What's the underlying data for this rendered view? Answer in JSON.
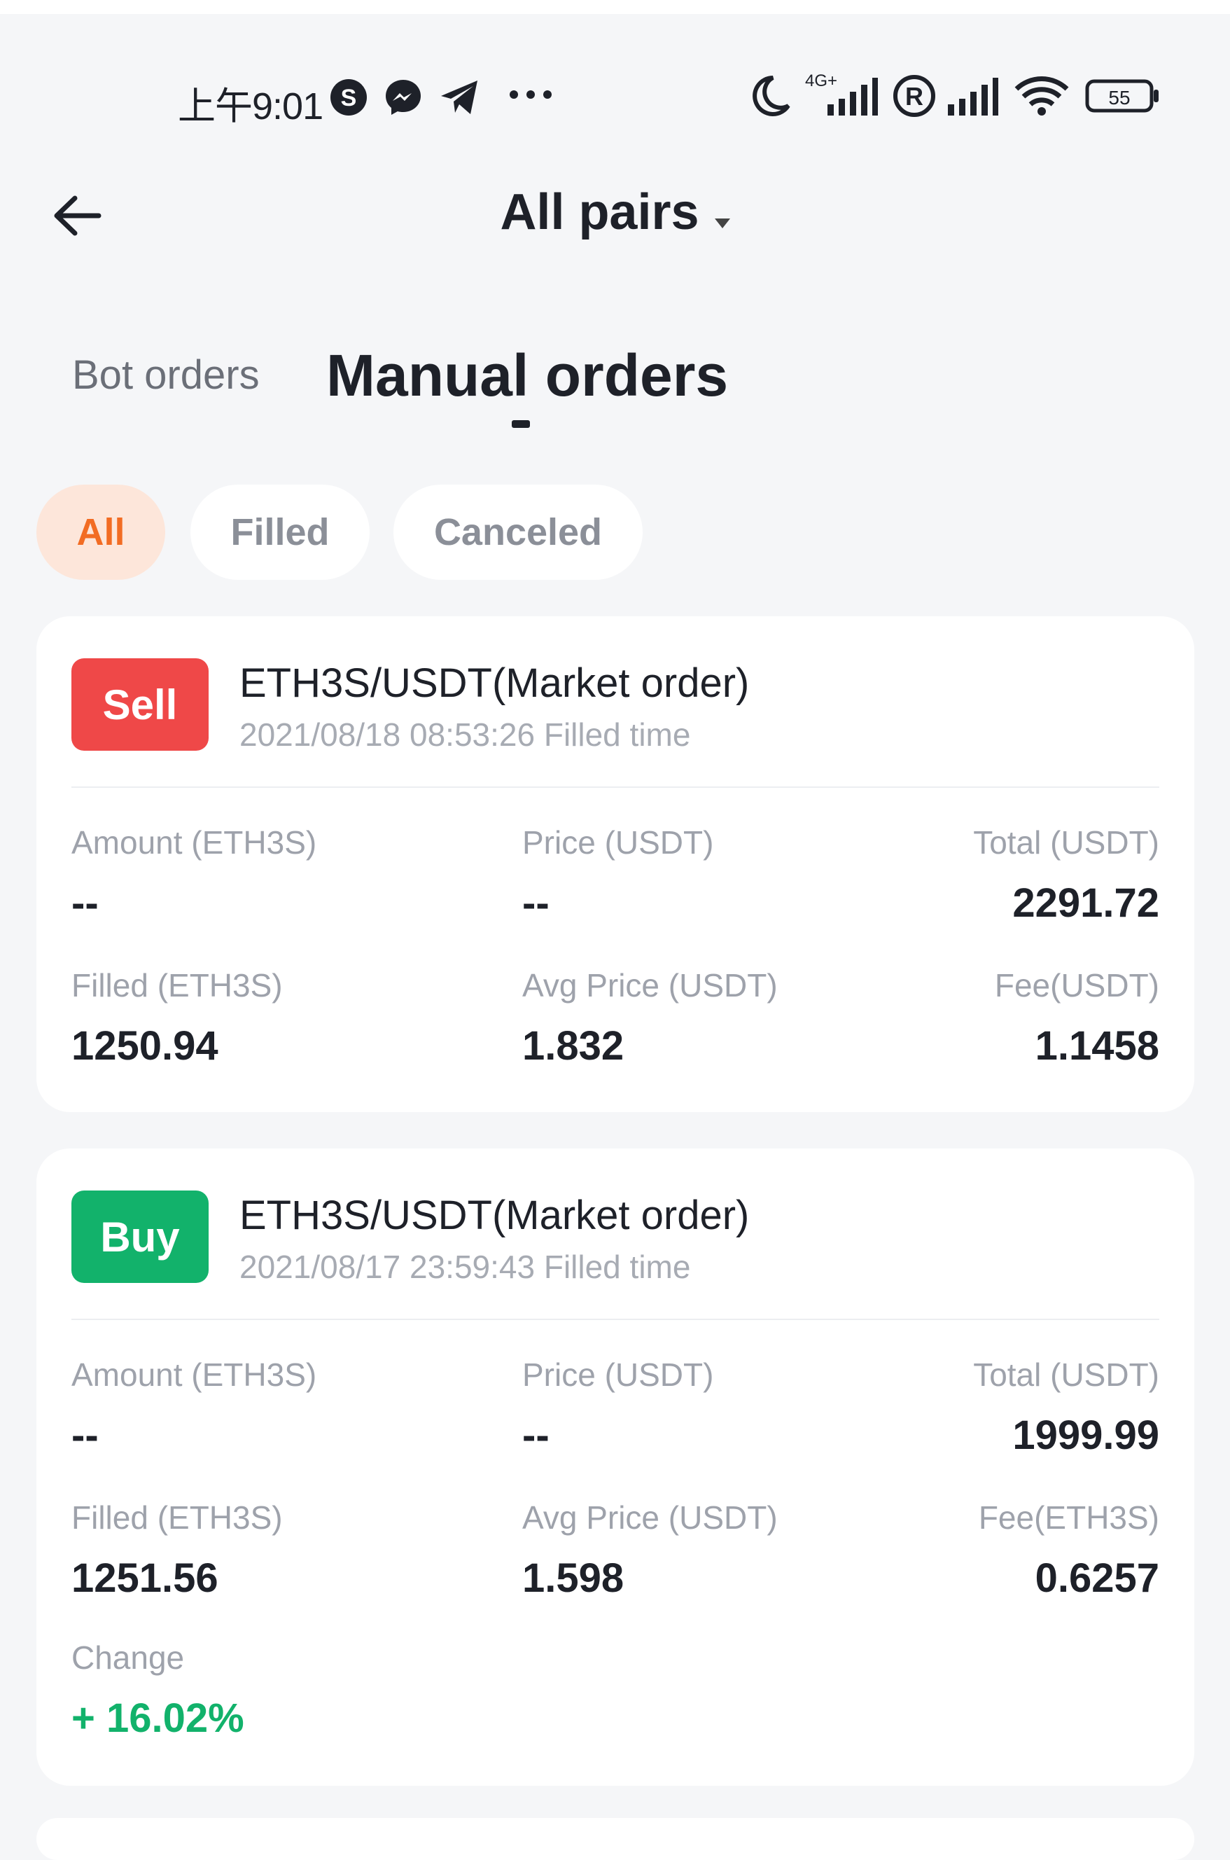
{
  "status_bar": {
    "time": "上午9:01",
    "network_label": "4G+",
    "battery": "55"
  },
  "header": {
    "title": "All pairs"
  },
  "tabs": [
    {
      "label": "Bot orders",
      "active": false
    },
    {
      "label": "Manual orders",
      "active": true
    }
  ],
  "filters": [
    {
      "label": "All",
      "active": true
    },
    {
      "label": "Filled",
      "active": false
    },
    {
      "label": "Canceled",
      "active": false
    }
  ],
  "orders": [
    {
      "side": "Sell",
      "side_color": "#ef4848",
      "pair": "ETH3S/USDT(Market order)",
      "time": "2021/08/18 08:53:26 Filled time",
      "amount_label": "Amount (ETH3S)",
      "amount_value": "--",
      "price_label": "Price (USDT)",
      "price_value": "--",
      "total_label": "Total (USDT)",
      "total_value": "2291.72",
      "filled_label": "Filled (ETH3S)",
      "filled_value": "1250.94",
      "avg_label": "Avg Price (USDT)",
      "avg_value": "1.832",
      "fee_label": "Fee(USDT)",
      "fee_value": "1.1458"
    },
    {
      "side": "Buy",
      "side_color": "#12b26b",
      "pair": "ETH3S/USDT(Market order)",
      "time": "2021/08/17 23:59:43 Filled time",
      "amount_label": "Amount (ETH3S)",
      "amount_value": "--",
      "price_label": "Price (USDT)",
      "price_value": "--",
      "total_label": "Total (USDT)",
      "total_value": "1999.99",
      "filled_label": "Filled (ETH3S)",
      "filled_value": "1251.56",
      "avg_label": "Avg Price (USDT)",
      "avg_value": "1.598",
      "fee_label": "Fee(ETH3S)",
      "fee_value": "0.6257",
      "change_label": "Change",
      "change_value": "+ 16.02%"
    }
  ],
  "colors": {
    "accent_orange": "#f26c23",
    "sell_red": "#ef4848",
    "buy_green": "#12b26b"
  }
}
